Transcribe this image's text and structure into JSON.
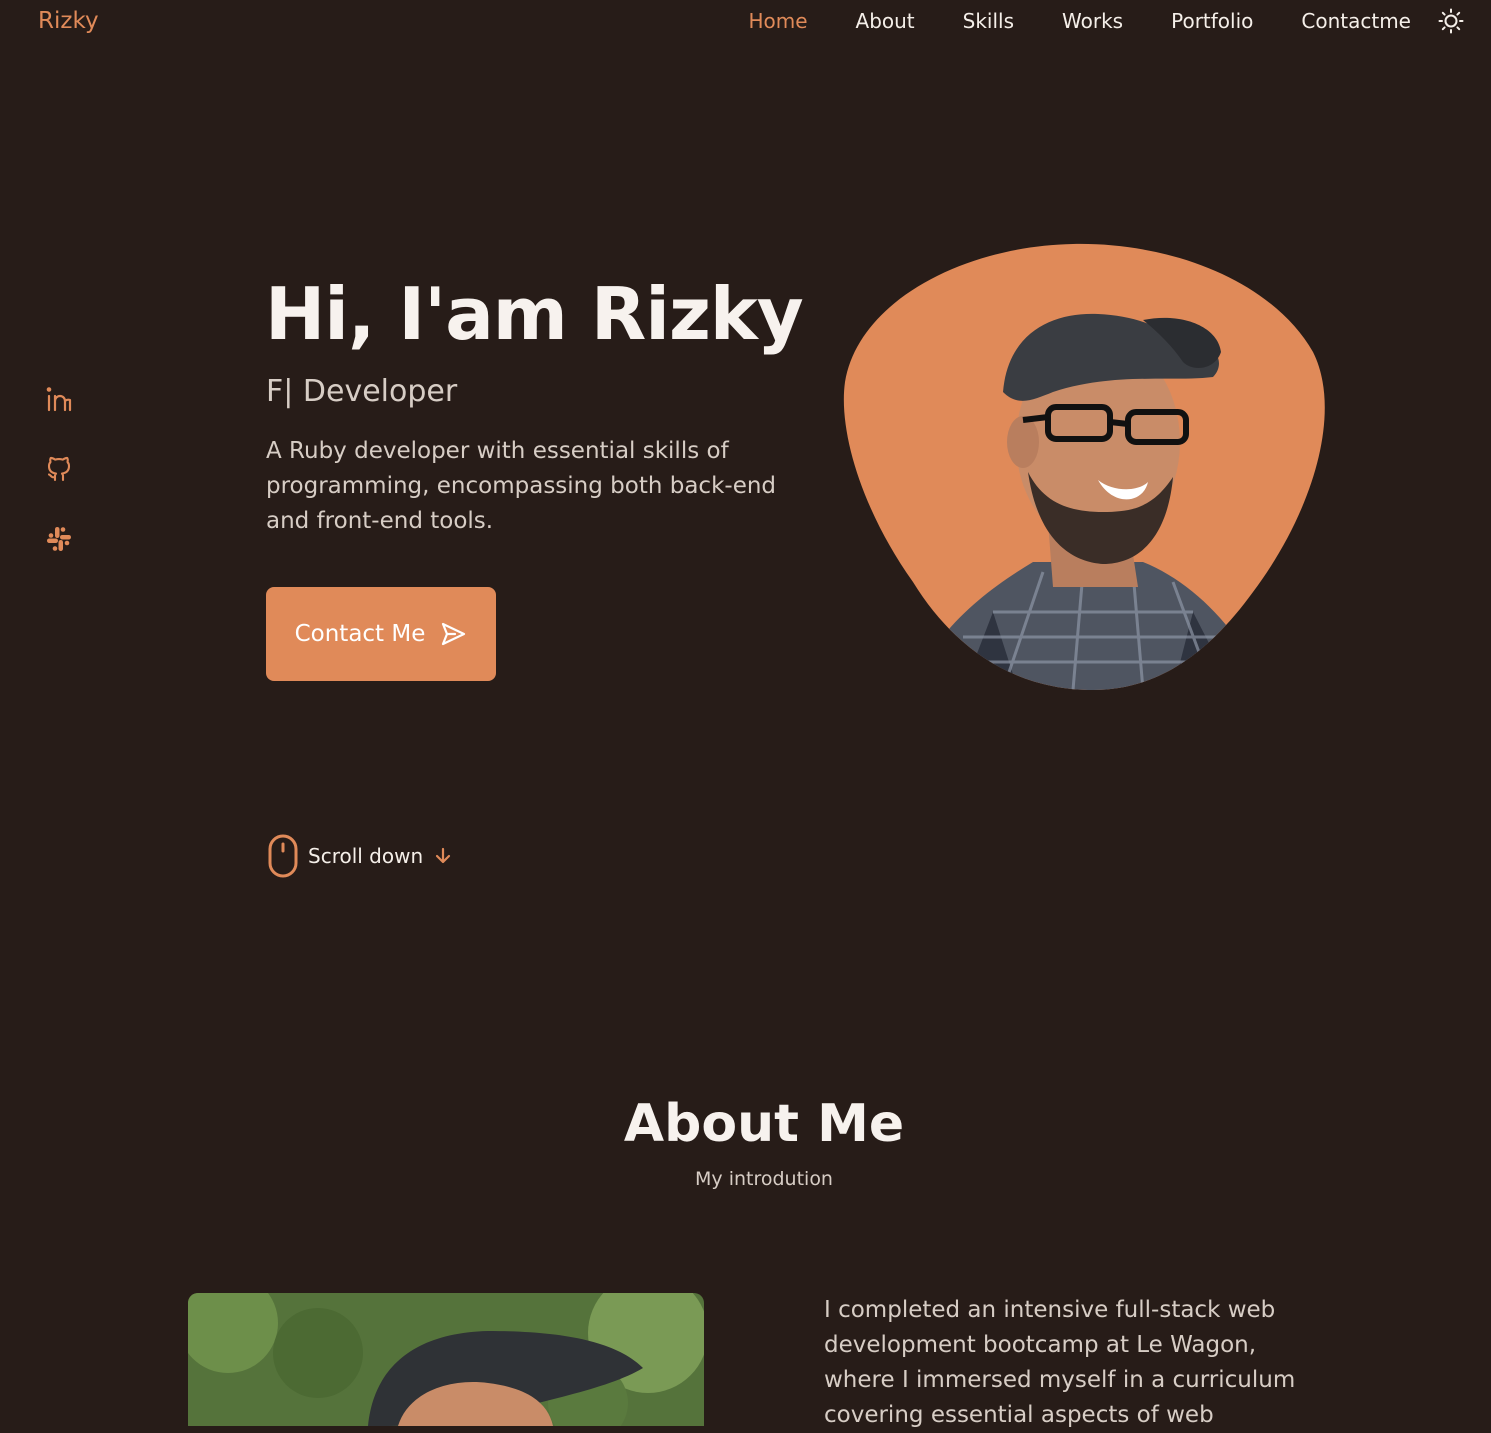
{
  "nav": {
    "logo": "Rizky",
    "links": [
      "Home",
      "About",
      "Skills",
      "Works",
      "Portfolio",
      "Contactme"
    ],
    "active": "Home",
    "theme_icon": "sun-icon"
  },
  "social": {
    "icons": [
      "linkedin-icon",
      "github-icon",
      "slack-icon"
    ]
  },
  "hero": {
    "title": "Hi, I'am Rizky",
    "subtitle": "F| Developer",
    "description": "A Ruby developer with essential skills of programming, encompassing both back-end and front-end tools.",
    "button_label": "Contact Me",
    "button_icon": "send-icon"
  },
  "scroll": {
    "label": "Scroll down",
    "mouse_icon": "mouse-icon",
    "arrow_icon": "arrow-down-icon"
  },
  "about": {
    "title": "About Me",
    "subtitle": "My introdution",
    "text": "I completed an intensive full-stack web development bootcamp at Le Wagon, where I immersed myself in a curriculum covering essential aspects of web"
  },
  "colors": {
    "background": "#271c18",
    "accent": "#e08a59",
    "text": "#f5efe9",
    "muted": "#d7cdc5"
  }
}
